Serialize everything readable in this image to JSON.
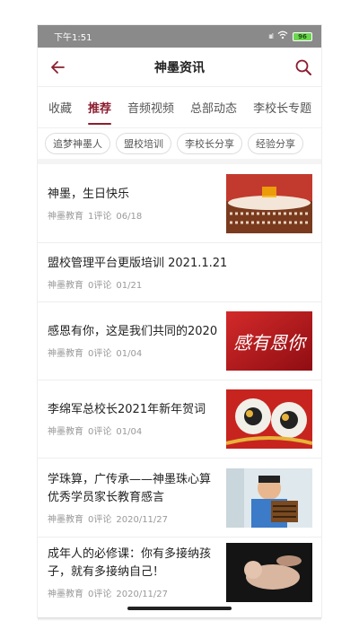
{
  "status": {
    "time": "下午1:51",
    "signal": "ıııl",
    "battery": "96"
  },
  "nav": {
    "title": "神墨资讯"
  },
  "tabs": [
    "收藏",
    "推荐",
    "音频视频",
    "总部动态",
    "李校长专题"
  ],
  "chips": [
    "追梦神墨人",
    "盟校培训",
    "李校长分享",
    "经验分享"
  ],
  "articles": [
    {
      "title": "神墨，生日快乐",
      "source": "神墨教育",
      "comments": "1评论",
      "date": "06/18",
      "thumb": "birthday-cake-image"
    },
    {
      "title": "盟校管理平台更版培训 2021.1.21",
      "source": "神墨教育",
      "comments": "0评论",
      "date": "01/21",
      "thumb": ""
    },
    {
      "title": "感恩有你，这是我们共同的2020",
      "source": "神墨教育",
      "comments": "0评论",
      "date": "01/04",
      "thumb": "calligraphy-image",
      "thumb_text": "感有恩你"
    },
    {
      "title": "李绵军总校长2021年新年贺词",
      "source": "神墨教育",
      "comments": "0评论",
      "date": "01/04",
      "thumb": "lion-dance-image"
    },
    {
      "title": "学珠算，广传承——神墨珠心算优秀学员家长教育感言",
      "source": "神墨教育",
      "comments": "0评论",
      "date": "2020/11/27",
      "thumb": "abacus-child-image"
    },
    {
      "title": "成年人的必修课：你有多接纳孩子，就有多接纳自己！",
      "source": "神墨教育",
      "comments": "0评论",
      "date": "2020/11/27",
      "thumb": "baby-image"
    }
  ],
  "colors": {
    "accent": "#8b1e2f",
    "statusbar": "#8a8a8a"
  }
}
